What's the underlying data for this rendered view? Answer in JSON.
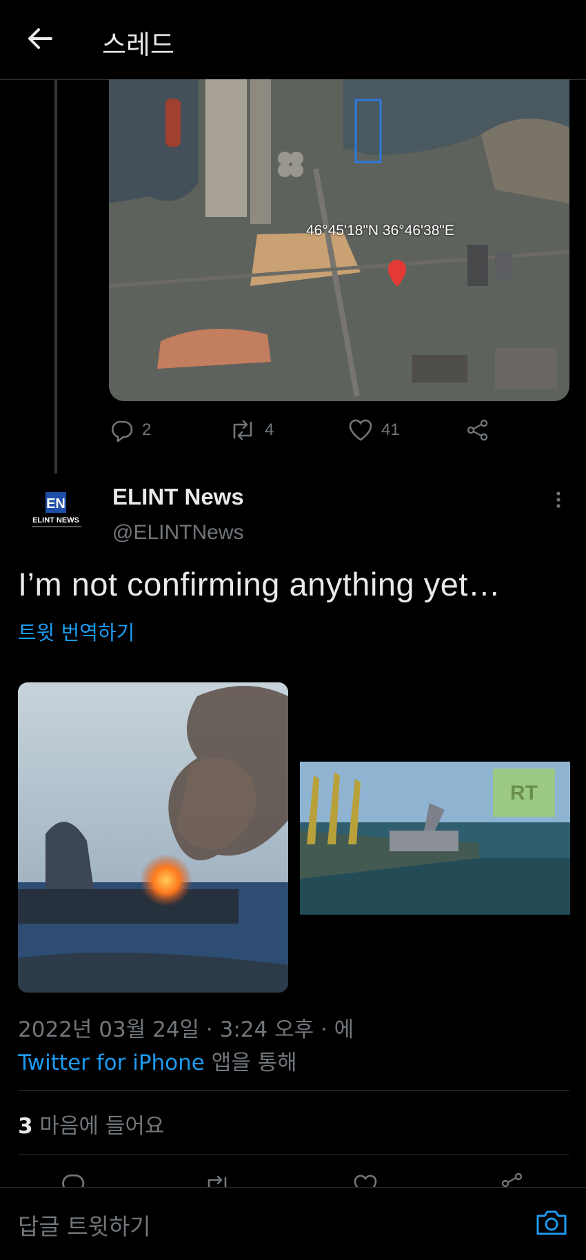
{
  "header": {
    "title": "스레드",
    "back_icon": "arrow-left-icon"
  },
  "previous_tweet": {
    "image_caption": "46°45'18\"N 36°46'38\"E",
    "actions": {
      "reply_count": "2",
      "retweet_count": "4",
      "like_count": "41"
    }
  },
  "tweet": {
    "author_name": "ELINT News",
    "author_handle": "@ELINTNews",
    "avatar_initials": "EN",
    "avatar_caption": "ELINT NEWS",
    "text": "I’m not confirming anything yet…",
    "translate_label": "트윗 번역하기",
    "media_watermark": "RT",
    "timestamp": "2022년 03월 24일 · 3:24 오후 · 에",
    "source_link": "Twitter for iPhone",
    "source_suffix": " 앱을 통해",
    "likes_count": "3",
    "likes_label": " 마음에 들어요"
  },
  "reply_bar": {
    "placeholder": "답글 트윗하기",
    "camera_icon": "camera-icon"
  },
  "colors": {
    "accent": "#1d9bf0",
    "muted": "#71767b",
    "background": "#000000"
  }
}
